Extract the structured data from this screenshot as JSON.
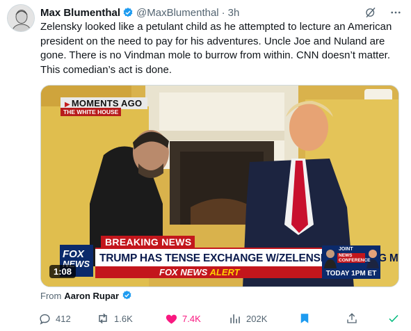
{
  "author": {
    "name": "Max Blumenthal",
    "handle": "@MaxBlumenthal",
    "separator": "·",
    "time": "3h"
  },
  "tweet_text": "Zelensky looked like a petulant child as he attempted to lecture an American president on the need to pay for his adventures. Uncle Joe and Nuland are gone. There is no Vindman mole to burrow from within. CNN doesn’t matter. This comedian’s act is done.",
  "media": {
    "overlay_moments": "MOMENTS AGO",
    "overlay_location": "THE WHITE HOUSE",
    "breaking": "BREAKING NEWS",
    "headline": "TRUMP HAS TENSE EXCHANGE W/ZELENSKYY DURING MTG",
    "alert_prefix": "FOX NEWS",
    "alert_suffix": "ALERT",
    "logo_line1": "FOX",
    "logo_line2": "NEWS",
    "joint_label": "JOINT",
    "joint_sub": "NEWS CONFERENCE",
    "today_label": "TODAY 1PM ET",
    "duration": "1:08"
  },
  "attribution": {
    "prefix": "From",
    "author": "Aaron Rupar"
  },
  "actions": {
    "replies": "412",
    "reposts": "1.6K",
    "likes": "7.4K",
    "views": "202K"
  },
  "colors": {
    "accent": "#1d9bf0",
    "like": "#f91880",
    "muted": "#536471",
    "text": "#0f1419"
  },
  "icons": [
    "verified-badge-icon",
    "grok-icon",
    "more-icon",
    "reply-icon",
    "repost-icon",
    "like-icon",
    "views-icon",
    "bookmark-icon",
    "share-icon",
    "check-icon"
  ]
}
